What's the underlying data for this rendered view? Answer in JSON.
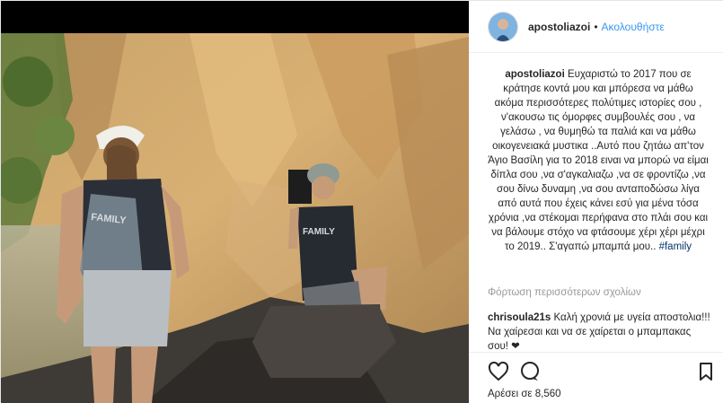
{
  "header": {
    "username": "apostoliazoi",
    "separator": "•",
    "follow_label": "Ακολουθήστε"
  },
  "caption": {
    "username": "apostoliazoi",
    "text": " Ευχαριστώ το 2017 που σε κράτησε κοντά μου και μπόρεσα να μάθω ακόμα περισσότερες πολύτιμες ιστορίες σου , ν'ακουσω τις όμορφες συμβουλές σου , να γελάσω , να θυμηθώ τα παλιά και να μάθω οικογενειακά μυστικα ..Αυτό που ζητάω απ'τον Άγιο Βασίλη για το 2018 ειναι να μπορώ να είμαι δίπλα σου ,να σ'αγκαλιαζω ,να σε φροντίζω ,να σου δίνω δυναμη ,να σου ανταποδώσω λίγα από αυτά που έχεις κάνει εσύ για μένα τόσα χρόνια ,να στέκομαι περήφανα στο πλάι σου και να βάλουμε στόχο να φτάσουμε χέρι χέρι μέχρι το 2019.. Σ'αγαπώ μπαμπά μου.. ",
    "hashtag": "#family"
  },
  "load_more": "Φόρτωση περισσότερων σχολίων",
  "comment": {
    "username": "chrisoula21s",
    "text": " Καλή χρονιά με υγεία αποστολια!!! Να χαίρεσαι και να σε χαίρεται ο μπαμπακας σου! ❤"
  },
  "actions": {
    "like_icon": "heart-icon",
    "comment_icon": "comment-bubble-icon",
    "save_icon": "bookmark-icon"
  },
  "likes": "Αρέσει σε 8,560",
  "photo": {
    "shirt_text_left": "FAMILY",
    "shirt_text_right": "FAMILY"
  },
  "colors": {
    "link_blue": "#3897f0",
    "hashtag": "#003569",
    "muted": "#999999"
  }
}
